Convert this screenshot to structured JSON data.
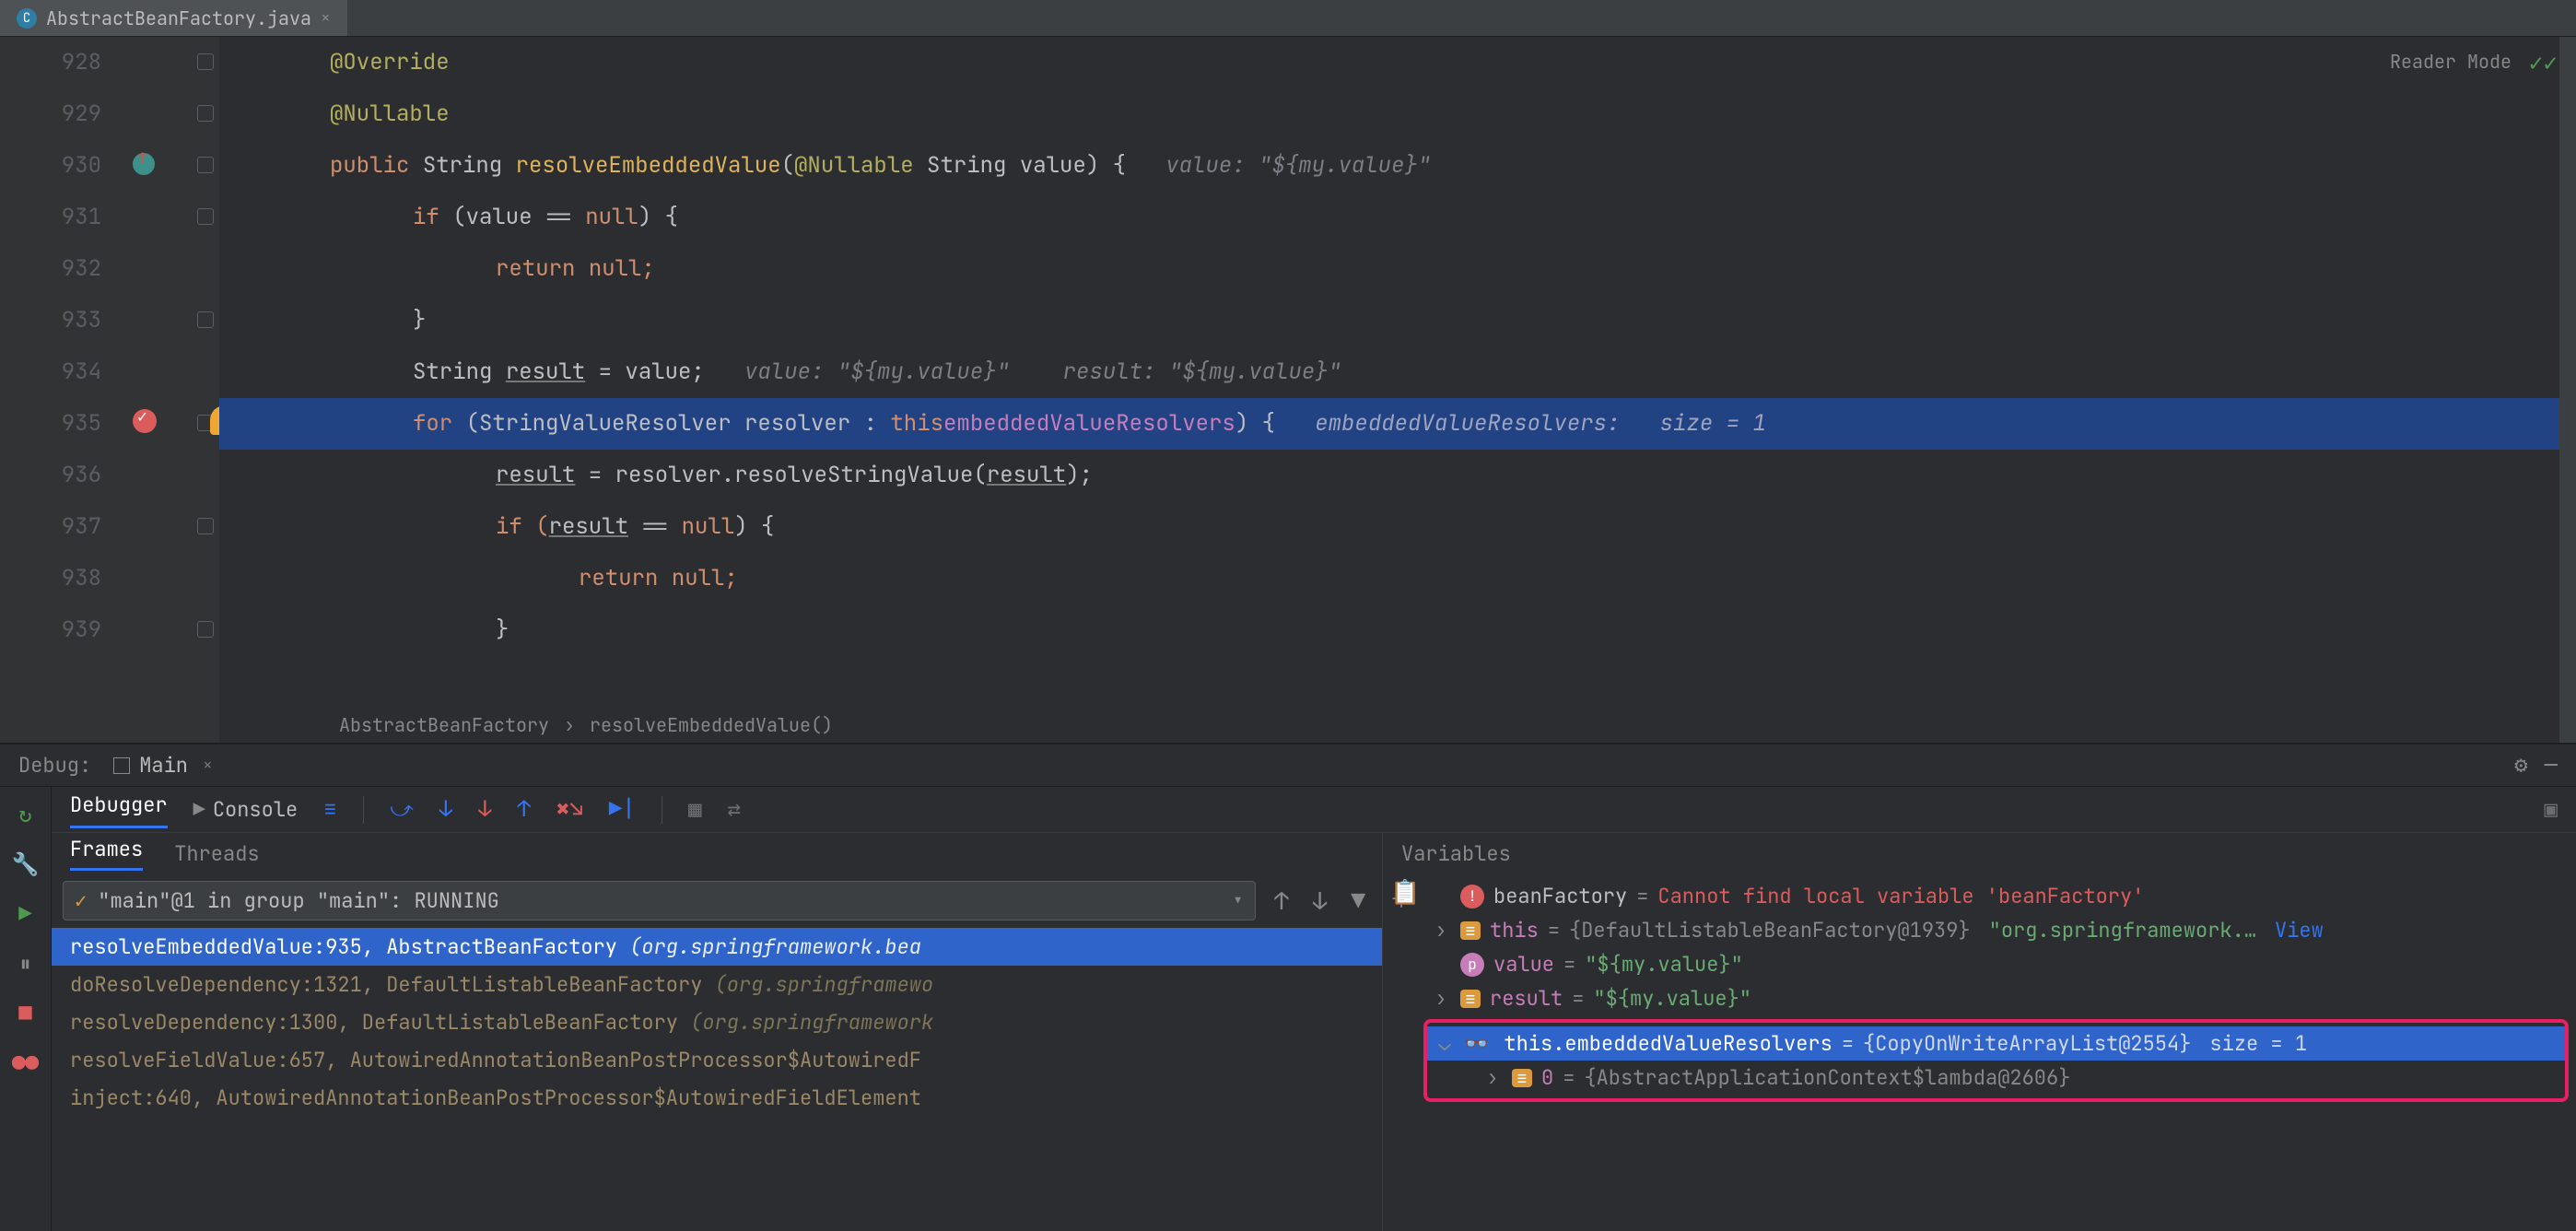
{
  "tab": {
    "title": "AbstractBeanFactory.java",
    "close": "×",
    "iconLetter": "C"
  },
  "reader": "Reader Mode",
  "breadcrumb": {
    "a": "AbstractBeanFactory",
    "sep": "›",
    "b": "resolveEmbeddedValue()"
  },
  "lines": {
    "928": "928",
    "929": "929",
    "930": "930",
    "931": "931",
    "932": "932",
    "933": "933",
    "934": "934",
    "935": "935",
    "936": "936",
    "937": "937",
    "938": "938",
    "939": "939"
  },
  "code": {
    "override": "@Override",
    "nullable": "@Nullable",
    "public": "public",
    "String": "String",
    "method": "resolveEmbeddedValue",
    "lp": "(",
    "nullableParam": "@Nullable",
    "paramType": "String",
    "paramName": "value",
    "rp": ") {",
    "hint930": "value: \"${my.value}\"",
    "if": "if",
    "cond": " (value == ",
    "null": "null",
    "rb": ") {",
    "return": "return",
    "semnull": "null;",
    "cb": "}",
    "decl": "String ",
    "resVar": "result",
    "assign": " = value;",
    "hint934a": "value: \"${my.value}\"",
    "hint934b": "result: \"${my.value}\"",
    "for": "for",
    "forOpen": " (StringValueResolver resolver : ",
    "this": "this",
    ".": ".",
    "fld": "embeddedValueResolvers",
    "forClose": ") {",
    "hint935a": "embeddedValueResolvers:",
    "hint935b": "size = 1",
    "r936a": "result",
    "r936b": " = resolver.resolveStringValue(",
    "r936c": "result",
    "r936d": ");",
    "if937": "if (",
    "r937": "result",
    "cond937": " == ",
    "null937": "null",
    "rb937": ") {",
    "ret938": "return",
    "null938": "null;",
    "cb939": "}"
  },
  "debug": {
    "label": "Debug:",
    "tab": "Main",
    "tool": {
      "debugger": "Debugger",
      "console": "Console"
    },
    "frames": {
      "tab1": "Frames",
      "tab2": "Threads",
      "sel": "\"main\"@1 in group \"main\": RUNNING",
      "rows": [
        {
          "m": "resolveEmbeddedValue:935, AbstractBeanFactory ",
          "p": "(org.springframework.bea",
          "sel": true
        },
        {
          "m": "doResolveDependency:1321, DefaultListableBeanFactory ",
          "p": "(org.springframewo"
        },
        {
          "m": "resolveDependency:1300, DefaultListableBeanFactory ",
          "p": "(org.springframework"
        },
        {
          "m": "resolveFieldValue:657, AutowiredAnnotationBeanPostProcessor$AutowiredF",
          "p": ""
        },
        {
          "m": "inject:640, AutowiredAnnotationBeanPostProcessor$AutowiredFieldElement",
          "p": ""
        }
      ]
    },
    "vars": {
      "title": "Variables",
      "rows": [
        {
          "t": "err",
          "name": "beanFactory",
          "val": "Cannot find local variable 'beanFactory'"
        },
        {
          "t": "obj",
          "name": "this",
          "obj": "{DefaultListableBeanFactory@1939}",
          "str": "\"org.springframework.…",
          "view": "View"
        },
        {
          "t": "p",
          "name": "value",
          "str": "\"${my.value}\""
        },
        {
          "t": "e",
          "name": "result",
          "str": "\"${my.value}\""
        }
      ],
      "boxed": {
        "top": {
          "name": "this.embeddedValueResolvers",
          "obj": "{CopyOnWriteArrayList@2554}",
          "extra": "size = 1"
        },
        "child": {
          "name": "0",
          "obj": "{AbstractApplicationContext$lambda@2606}"
        }
      }
    }
  }
}
